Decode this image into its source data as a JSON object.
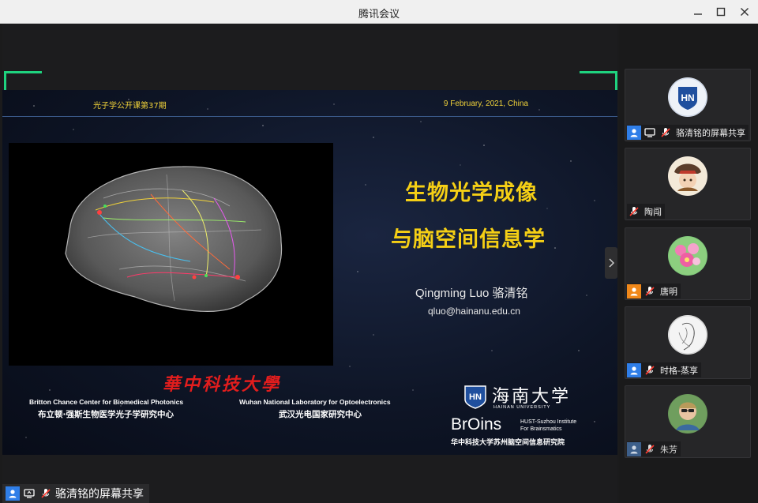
{
  "window": {
    "title": "腾讯会议"
  },
  "slide": {
    "header_left": "光子学公开课第37期",
    "header_right": "9 February, 2021, China",
    "title_line1": "生物光学成像",
    "title_line2": "与脑空间信息学",
    "author": "Qingming Luo 骆清铭",
    "email": "qluo@hainanu.edu.cn",
    "hust_logo": "華中科技大學",
    "inst1_en": "Britton Chance Center for Biomedical Photonics",
    "inst1_cn": "布立顿·强斯生物医学光子学研究中心",
    "inst2_en": "Wuhan National Laboratory for Optoelectronics",
    "inst2_cn": "武汉光电国家研究中心",
    "hainan_cn": "海南大学",
    "hainan_en": "HAINAN UNIVERSITY",
    "brains_logo": "BrOins",
    "brains_sub1": "HUST-Suzhou Institute",
    "brains_sub2": "For Brainsmatics",
    "brains_cn": "华中科技大学苏州脑空间信息研究院"
  },
  "stage": {
    "share_label": "骆清铭的屏幕共享"
  },
  "participants": [
    {
      "name": "骆清铭的屏幕共享",
      "role_color": "#2f7ee8",
      "avatar": "hn-logo"
    },
    {
      "name": "陶闯",
      "avatar": "cartoon-avatar"
    },
    {
      "name": "唐明",
      "role_color": "#f0881a",
      "avatar": "flower-avatar"
    },
    {
      "name": "时格-蒸享",
      "role_color": "#2f7ee8",
      "avatar": "sketch-avatar"
    },
    {
      "name": "朱芳",
      "role_color": "#3d5f8a",
      "avatar": "photo-avatar"
    }
  ],
  "colors": {
    "accent_green": "#1fd37f",
    "slide_yellow": "#f5cf15",
    "hust_red": "#e21d1d"
  }
}
